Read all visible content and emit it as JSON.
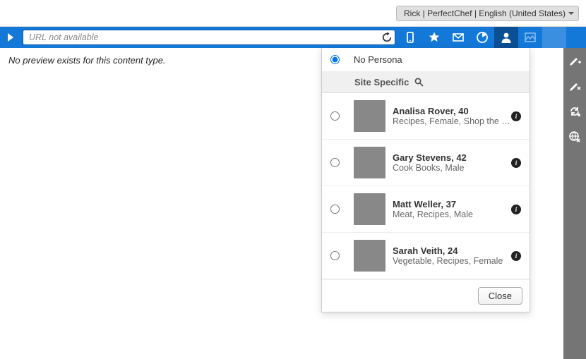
{
  "header": {
    "user_label": "Rick | PerfectChef | English (United States)"
  },
  "toolbar": {
    "url_text": "URL not available"
  },
  "content": {
    "empty_message": "No preview exists for this content type."
  },
  "persona_panel": {
    "no_persona_label": "No Persona",
    "group_label": "Site Specific",
    "close_label": "Close",
    "selected": "none",
    "items": [
      {
        "name": "Analisa Rover, 40",
        "desc": "Recipes, Female, Shop the L..."
      },
      {
        "name": "Gary Stevens, 42",
        "desc": "Cook Books, Male"
      },
      {
        "name": "Matt Weller, 37",
        "desc": "Meat, Recipes, Male"
      },
      {
        "name": "Sarah Veith, 24",
        "desc": "Vegetable, Recipes, Female"
      }
    ]
  }
}
